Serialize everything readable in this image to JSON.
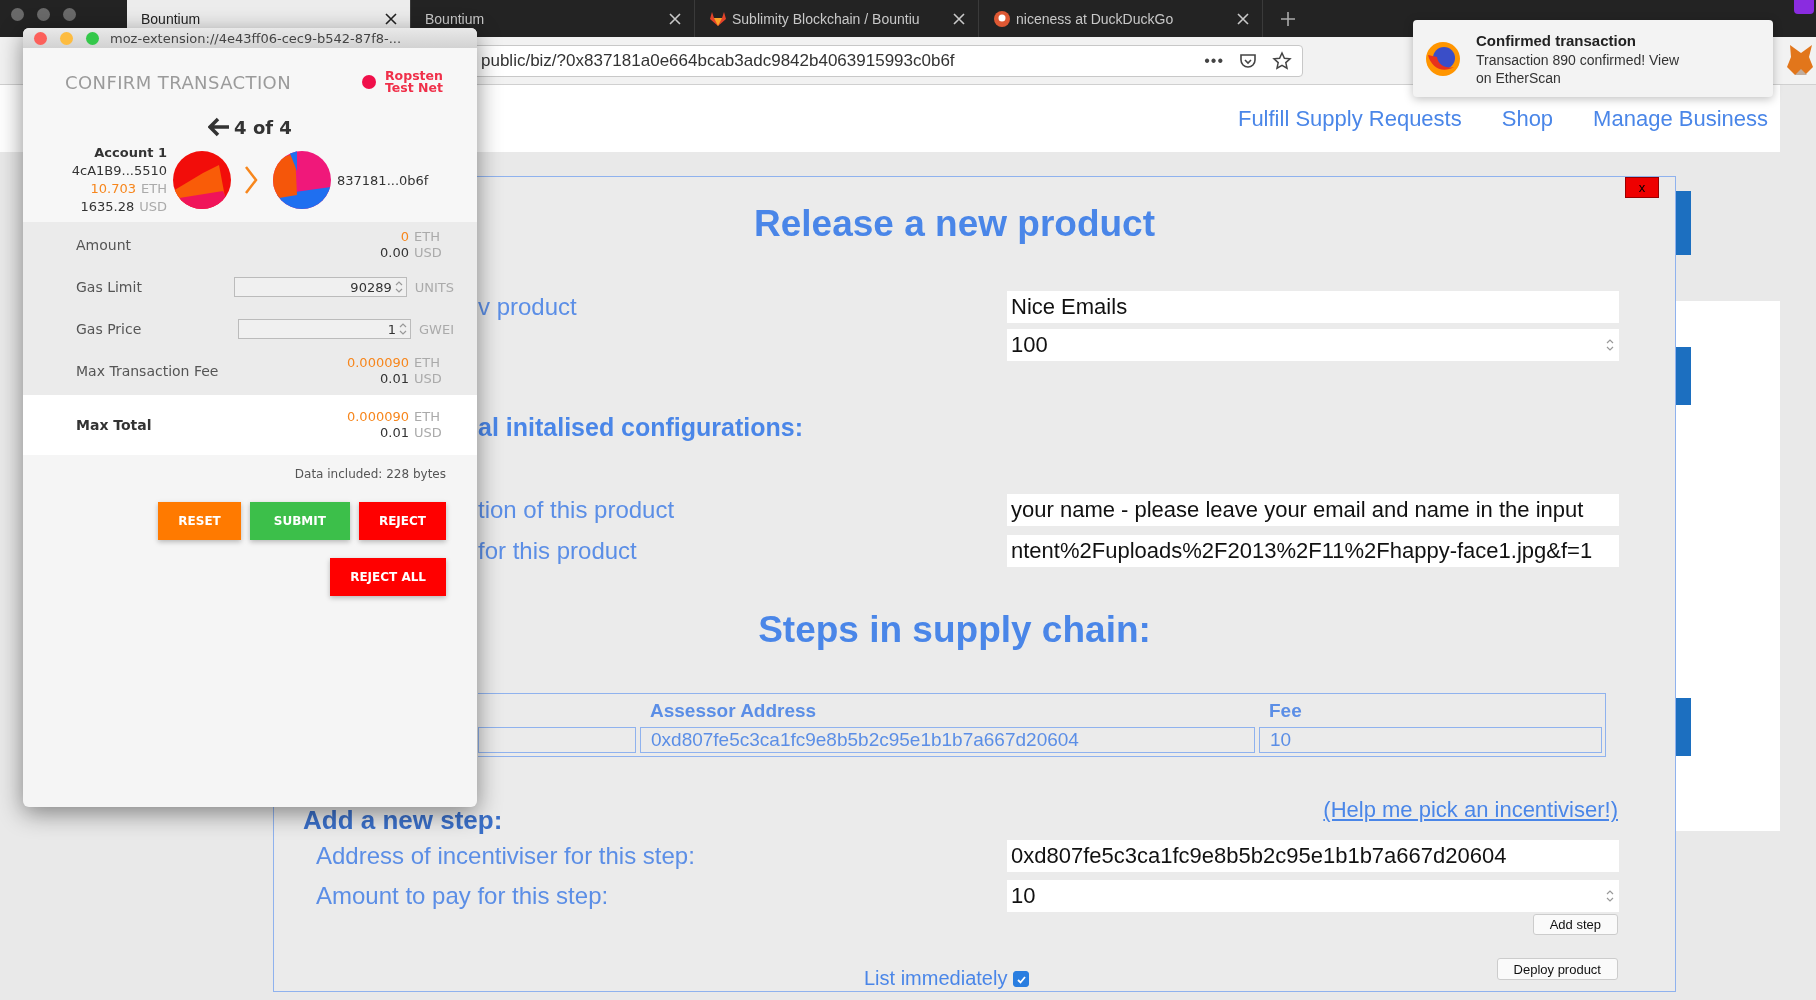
{
  "browser": {
    "tabs": [
      {
        "label": "Bountium",
        "selected": true
      },
      {
        "label": "Bountium",
        "selected": false
      },
      {
        "label": "Sublimity Blockchain / Bountiu",
        "selected": false
      },
      {
        "label": "niceness at DuckDuckGo",
        "selected": false
      }
    ],
    "url": "public/biz/?0x837181a0e664bcab3adc9842b4063915993c0b6f",
    "page_actions": "•••"
  },
  "notification": {
    "title": "Confirmed transaction",
    "lines": [
      "Transaction 890 confirmed! View",
      "on EtherScan"
    ]
  },
  "nav": [
    "Fulfill Supply Requests",
    "Shop",
    "Manage Business"
  ],
  "modal": {
    "close_label": "x",
    "title": "Release a new product",
    "product_fields": [
      {
        "label": "v product",
        "value": "Nice Emails",
        "kind": "text"
      },
      {
        "value": "100",
        "kind": "number"
      }
    ],
    "config_heading": "al initalised configurations:",
    "config_fields": [
      {
        "label": "tion of this product",
        "value": "your name - please leave your email and name in the input",
        "kind": "text"
      },
      {
        "label": "for this product",
        "value": "ntent%2Fuploads%2F2013%2F11%2Fhappy-face1.jpg&f=1",
        "kind": "text"
      }
    ],
    "steps_heading": "Steps in supply chain:",
    "steps_table": {
      "columns": [
        "Assessor Address",
        "Fee"
      ],
      "rows": [
        [
          "0xd807fe5c3ca1fc9e8b5b2c95e1b1b7a667d20604",
          "10"
        ]
      ]
    },
    "help_link": "(Help me pick an incentiviser!)",
    "new_step": {
      "heading": "Add a new step:",
      "fields": [
        {
          "label": "Address of incentiviser for this step:",
          "value": "0xd807fe5c3ca1fc9e8b5b2c95e1b1b7a667d20604",
          "kind": "text"
        },
        {
          "label": "Amount to pay for this step:",
          "value": "10",
          "kind": "number"
        }
      ],
      "add_button": "Add step"
    },
    "list_immediately": {
      "label": "List immediately",
      "checked": true
    },
    "deploy_button": "Deploy product"
  },
  "popup": {
    "address": "moz-extension://4e43ff06-cec9-b542-87f8-...",
    "title": "CONFIRM TRANSACTION",
    "network": [
      "Ropsten",
      "Test Net"
    ],
    "counter": "4 of 4",
    "sender": {
      "name": "Account 1",
      "address": "4cA1B9...5510",
      "balance": "10.703",
      "balance_unit": "ETH",
      "fiat": "1635.28",
      "fiat_unit": "USD"
    },
    "recipient": {
      "address": "837181...0b6f"
    },
    "rows": [
      {
        "kind": "amount",
        "label": "Amount",
        "value": "0",
        "unit": "ETH",
        "fiat": "0.00",
        "fiat_unit": "USD"
      },
      {
        "kind": "input",
        "label": "Gas Limit",
        "value": "90289",
        "unit": "UNITS"
      },
      {
        "kind": "input",
        "label": "Gas Price",
        "value": "1",
        "unit": "GWEI"
      },
      {
        "kind": "amount",
        "label": "Max Transaction Fee",
        "value": "0.000090",
        "unit": "ETH",
        "fiat": "0.01",
        "fiat_unit": "USD"
      },
      {
        "kind": "total",
        "label": "Max Total",
        "value": "0.000090",
        "unit": "ETH",
        "fiat": "0.01",
        "fiat_unit": "USD"
      }
    ],
    "data_note": "Data included: 228 bytes",
    "button_rows": [
      [
        {
          "label": "RESET",
          "kind": "reset"
        },
        {
          "label": "SUBMIT",
          "kind": "submit"
        },
        {
          "label": "REJECT",
          "kind": "reject"
        }
      ],
      [
        {
          "label": "REJECT ALL",
          "kind": "reject"
        }
      ]
    ]
  }
}
